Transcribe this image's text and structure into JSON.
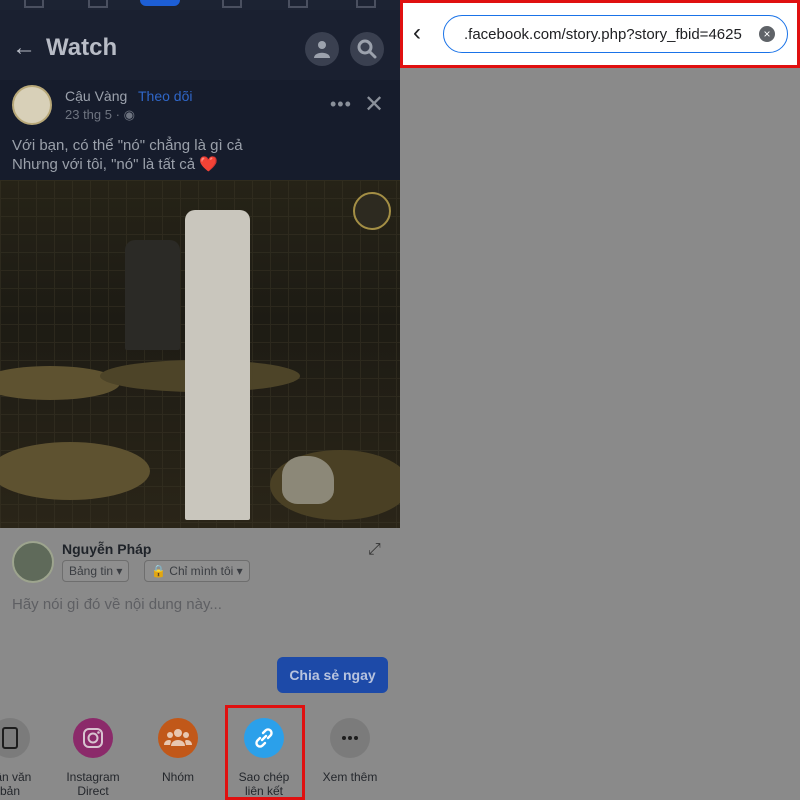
{
  "left_panel": {
    "header_title": "Watch",
    "post": {
      "author": "Cậu Vàng",
      "follow_label": "Theo dõi",
      "date": "23 thg 5 ·",
      "line1": "Với bạn, có thể \"nó\" chẳng là gì cả",
      "line2": "Nhưng với tôi, \"nó\" là tất cả",
      "heart": "❤️"
    },
    "share": {
      "user_name": "Nguyễn Pháp",
      "audience_feed": "Bảng tin",
      "audience_privacy": "Chỉ mình tôi",
      "placeholder": "Hãy nói gì đó về nội dung này...",
      "share_now": "Chia sẻ ngay"
    },
    "apps": [
      {
        "label_line1": "hận văn",
        "label_line2": "bản",
        "icon": "phone-icon",
        "color": "#7b7b7b"
      },
      {
        "label_line1": "Instagram",
        "label_line2": "Direct",
        "icon": "instagram-icon",
        "color": "#8b2a6a"
      },
      {
        "label_line1": "Nhóm",
        "label_line2": "",
        "icon": "group-icon",
        "color": "#c15819"
      },
      {
        "label_line1": "Sao chép",
        "label_line2": "liên kết",
        "icon": "link-icon",
        "color": "#2ba0ea"
      },
      {
        "label_line1": "Xem thêm",
        "label_line2": "",
        "icon": "more-icon",
        "color": "#7b7b7b"
      }
    ]
  },
  "browser": {
    "url": ".facebook.com/story.php?story_fbid=4625"
  }
}
